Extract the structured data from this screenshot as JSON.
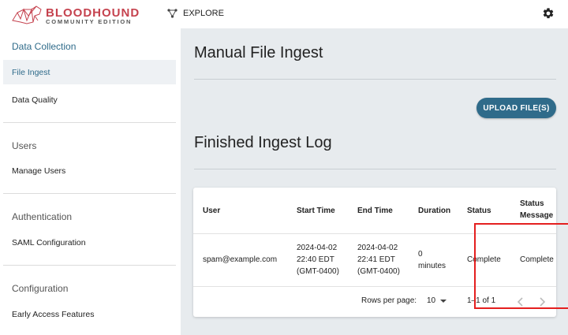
{
  "app": {
    "brand_name": "BLOODHOUND",
    "brand_edition": "COMMUNITY EDITION",
    "explore_label": "EXPLORE"
  },
  "sidebar": {
    "sections": [
      {
        "title": "Data Collection",
        "items": [
          {
            "label": "File Ingest",
            "selected": true
          },
          {
            "label": "Data Quality"
          }
        ]
      },
      {
        "title": "Users",
        "items": [
          {
            "label": "Manage Users"
          }
        ]
      },
      {
        "title": "Authentication",
        "items": [
          {
            "label": "SAML Configuration"
          }
        ]
      },
      {
        "title": "Configuration",
        "items": [
          {
            "label": "Early Access Features"
          }
        ]
      }
    ]
  },
  "main": {
    "title": "Manual File Ingest",
    "upload_label": "UPLOAD FILE(S)",
    "log_title": "Finished Ingest Log",
    "table": {
      "headers": [
        "User",
        "Start Time",
        "End Time",
        "Duration",
        "Status",
        [
          "Status",
          "Message"
        ]
      ],
      "rows": [
        {
          "user": "spam@example.com",
          "start": [
            "2024-04-02",
            "22:40 EDT",
            "(GMT-0400)"
          ],
          "end": [
            "2024-04-02",
            "22:41 EDT",
            "(GMT-0400)"
          ],
          "duration": [
            "0",
            "minutes"
          ],
          "status": "Complete",
          "message": "Complete"
        }
      ]
    },
    "pagination": {
      "rows_per_page_label": "Rows per page:",
      "rows_per_page": "10",
      "range": "1–1 of 1"
    }
  },
  "colors": {
    "accent": "#2f6b8a",
    "brand": "#c5424e",
    "highlight": "#e41f1f"
  }
}
